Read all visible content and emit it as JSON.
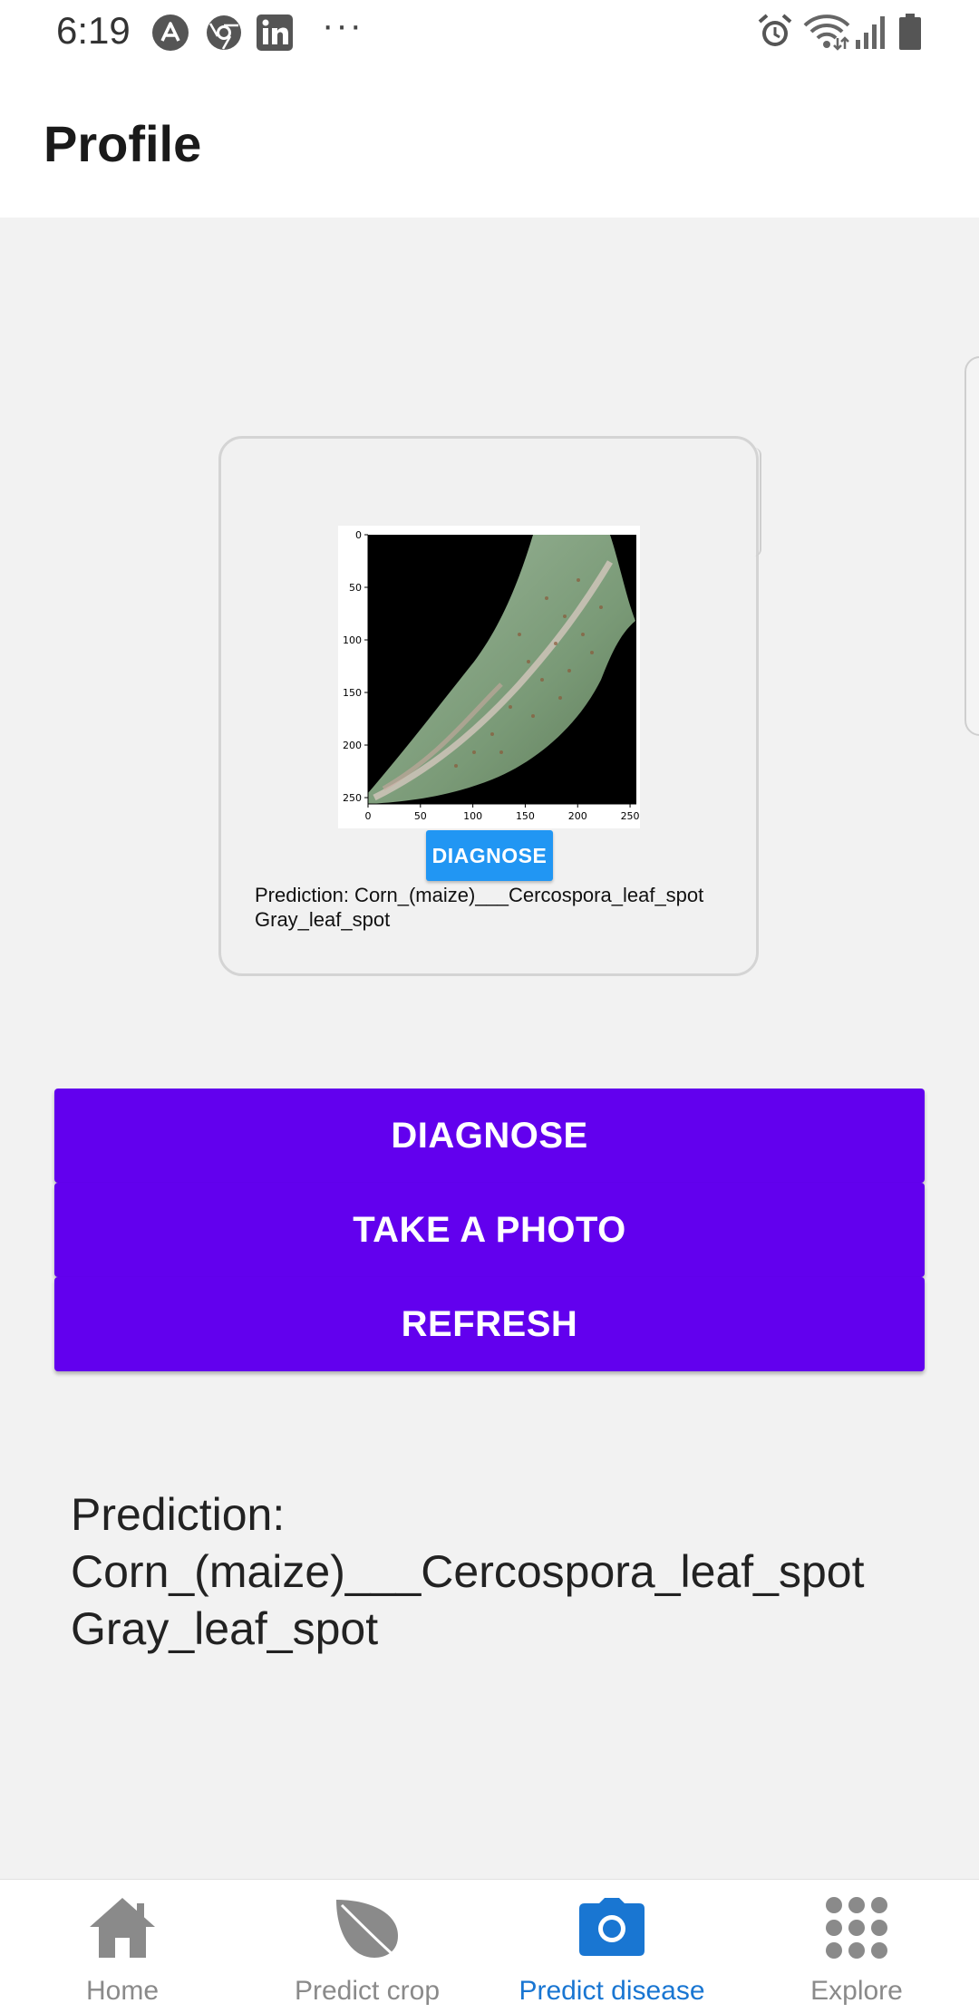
{
  "status_bar": {
    "time": "6:19",
    "left_icons": [
      "arc-icon",
      "chrome-icon",
      "linkedin-icon"
    ],
    "more": "···",
    "right_icons": [
      "alarm-icon",
      "wifi-icon",
      "signal-icon",
      "battery-icon"
    ]
  },
  "header": {
    "title": "Profile"
  },
  "card": {
    "image": {
      "x_ticks": [
        "0",
        "50",
        "100",
        "150",
        "200",
        "250"
      ],
      "y_ticks": [
        "0",
        "50",
        "100",
        "150",
        "200",
        "250"
      ]
    },
    "diagnose_label": "DIAGNOSE",
    "prediction_line1": "Prediction: Corn_(maize)___Cercospora_leaf_spot",
    "prediction_line2": "Gray_leaf_spot"
  },
  "actions": {
    "diagnose_label": "DIAGNOSE",
    "take_photo_label": "TAKE A PHOTO",
    "refresh_label": "REFRESH"
  },
  "result": {
    "line1": "Prediction:",
    "line2": "Corn_(maize)___Cercospora_leaf_spot",
    "line3": "Gray_leaf_spot"
  },
  "bottom_nav": {
    "items": [
      {
        "label": "Home",
        "icon": "home-icon",
        "active": false
      },
      {
        "label": "Predict crop",
        "icon": "leaf-icon",
        "active": false
      },
      {
        "label": "Predict disease",
        "icon": "camera-icon",
        "active": true
      },
      {
        "label": "Explore",
        "icon": "grid-icon",
        "active": false
      }
    ],
    "active_color": "#1976d2",
    "inactive_color": "#8a8a8a"
  },
  "colors": {
    "primary_button": "#6200ee",
    "small_button": "#2196f3",
    "background": "#f2f2f2"
  }
}
